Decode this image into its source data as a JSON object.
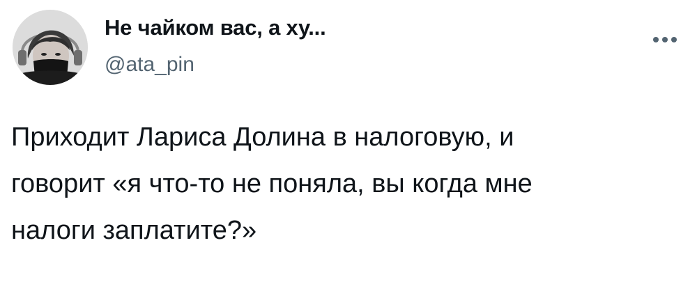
{
  "author": {
    "display_name": "Не чайком вас, а ху...",
    "handle": "@ata_pin",
    "avatar": "profile-photo"
  },
  "actions": {
    "more_icon": "more-horizontal-icon"
  },
  "tweet": {
    "text": "Приходит Лариса Долина в налоговую, и\nговорит «я что-то не поняла, вы когда мне\nналоги заплатите?»"
  }
}
